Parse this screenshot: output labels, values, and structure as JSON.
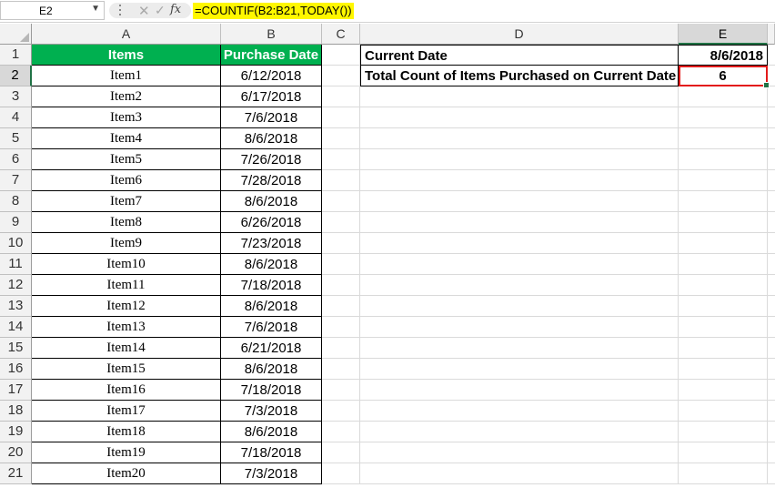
{
  "formula_bar": {
    "name_box": "E2",
    "name_box_icon": "chevron-down-icon",
    "fx_label": "fx",
    "formula": "=COUNTIF(B2:B21,TODAY())"
  },
  "columns": [
    "A",
    "B",
    "C",
    "D",
    "E"
  ],
  "rows": [
    "1",
    "2",
    "3",
    "4",
    "5",
    "6",
    "7",
    "8",
    "9",
    "10",
    "11",
    "12",
    "13",
    "14",
    "15",
    "16",
    "17",
    "18",
    "19",
    "20",
    "21"
  ],
  "table": {
    "header_items": "Items",
    "header_date": "Purchase Date",
    "header_color": "#00b050",
    "data": [
      {
        "item": "Item1",
        "date": "6/12/2018"
      },
      {
        "item": "Item2",
        "date": "6/17/2018"
      },
      {
        "item": "Item3",
        "date": "7/6/2018"
      },
      {
        "item": "Item4",
        "date": "8/6/2018"
      },
      {
        "item": "Item5",
        "date": "7/26/2018"
      },
      {
        "item": "Item6",
        "date": "7/28/2018"
      },
      {
        "item": "Item7",
        "date": "8/6/2018"
      },
      {
        "item": "Item8",
        "date": "6/26/2018"
      },
      {
        "item": "Item9",
        "date": "7/23/2018"
      },
      {
        "item": "Item10",
        "date": "8/6/2018"
      },
      {
        "item": "Item11",
        "date": "7/18/2018"
      },
      {
        "item": "Item12",
        "date": "8/6/2018"
      },
      {
        "item": "Item13",
        "date": "7/6/2018"
      },
      {
        "item": "Item14",
        "date": "6/21/2018"
      },
      {
        "item": "Item15",
        "date": "8/6/2018"
      },
      {
        "item": "Item16",
        "date": "7/18/2018"
      },
      {
        "item": "Item17",
        "date": "7/3/2018"
      },
      {
        "item": "Item18",
        "date": "8/6/2018"
      },
      {
        "item": "Item19",
        "date": "7/18/2018"
      },
      {
        "item": "Item20",
        "date": "7/3/2018"
      }
    ]
  },
  "summary": {
    "current_date_label": "Current Date",
    "current_date_value": "8/6/2018",
    "count_label": "Total Count of Items Purchased on Current Date",
    "count_value": "6",
    "highlight_color": "#e31b1b"
  },
  "selected_cell": "E2"
}
